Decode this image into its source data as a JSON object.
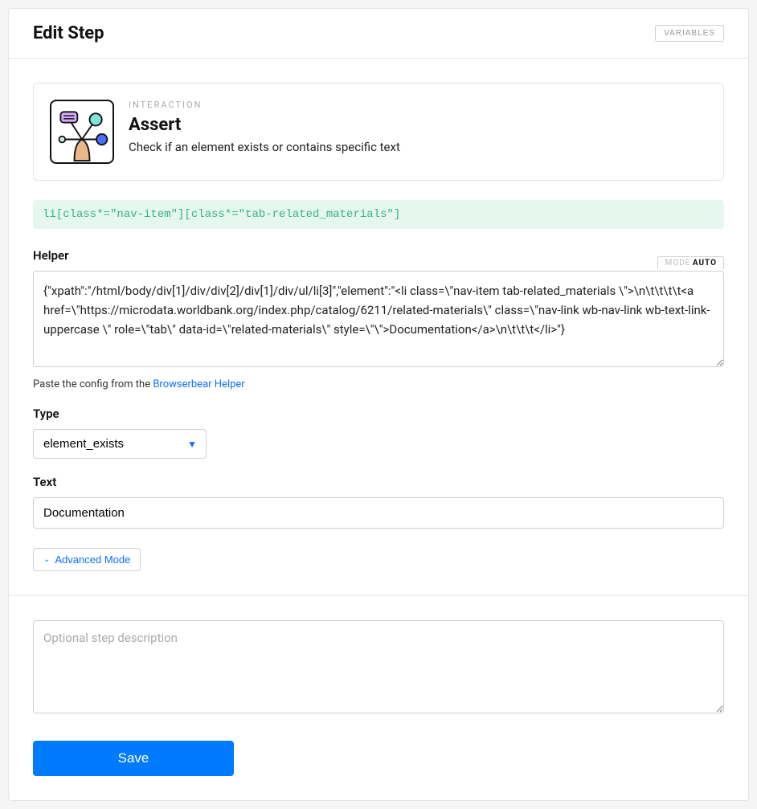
{
  "header": {
    "title": "Edit Step",
    "variables_btn": "VARIABLES"
  },
  "interaction": {
    "overline": "INTERACTION",
    "title": "Assert",
    "description": "Check if an element exists or contains specific text"
  },
  "selector": "li[class*=\"nav-item\"][class*=\"tab-related_materials\"]",
  "helper": {
    "label": "Helper",
    "mode_label": "MODE",
    "mode_value": "AUTO",
    "value": "{\"xpath\":\"/html/body/div[1]/div/div[2]/div[1]/div/ul/li[3]\",\"element\":\"<li class=\\\"nav-item tab-related_materials \\\">\\n\\t\\t\\t\\t<a href=\\\"https://microdata.worldbank.org/index.php/catalog/6211/related-materials\\\" class=\\\"nav-link wb-nav-link wb-text-link-uppercase \\\" role=\\\"tab\\\" data-id=\\\"related-materials\\\" style=\\\"\\\">Documentation</a>\\n\\t\\t\\t</li>\"}",
    "hint_prefix": "Paste the config from the ",
    "hint_link": "Browserbear Helper"
  },
  "type": {
    "label": "Type",
    "selected": "element_exists"
  },
  "text": {
    "label": "Text",
    "value": "Documentation"
  },
  "advanced": {
    "label": "Advanced Mode"
  },
  "description": {
    "placeholder": "Optional step description"
  },
  "actions": {
    "save": "Save"
  }
}
